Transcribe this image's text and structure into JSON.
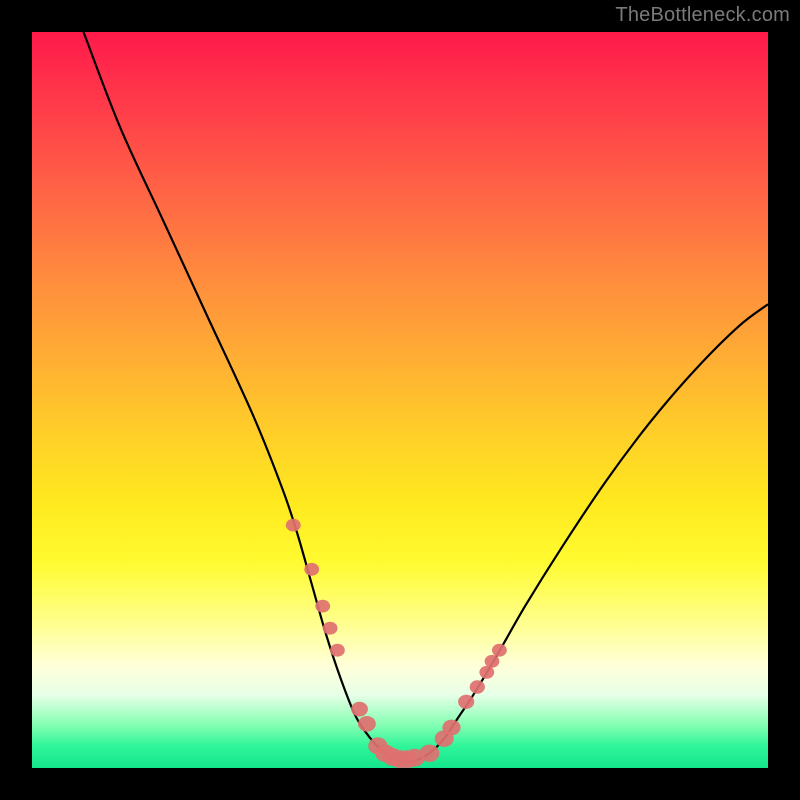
{
  "watermark": "TheBottleneck.com",
  "chart_data": {
    "type": "line",
    "title": "",
    "xlabel": "",
    "ylabel": "",
    "xlim": [
      0,
      100
    ],
    "ylim": [
      0,
      100
    ],
    "grid": false,
    "series": [
      {
        "name": "curve",
        "x": [
          7,
          12,
          18,
          24,
          30,
          34,
          36,
          38,
          40,
          42,
          44,
          46,
          48,
          50,
          52,
          54,
          56,
          58,
          60,
          63,
          67,
          72,
          78,
          84,
          90,
          96,
          100
        ],
        "y": [
          100,
          87,
          74,
          61,
          48,
          38,
          32,
          25,
          18,
          12,
          7,
          4,
          2,
          1,
          1,
          2,
          4,
          7,
          10,
          15,
          22,
          30,
          39,
          47,
          54,
          60,
          63
        ],
        "color": "#000000"
      },
      {
        "name": "marker-dots",
        "x": [
          35.5,
          38,
          39.5,
          40.5,
          41.5,
          44.5,
          45.5,
          47,
          48,
          49,
          50,
          51,
          52,
          54,
          56,
          57,
          59,
          60.5,
          61.8,
          62.5,
          63.5
        ],
        "y": [
          33,
          27,
          22,
          19,
          16,
          8,
          6,
          3,
          2,
          1.5,
          1.2,
          1.2,
          1.4,
          2,
          4,
          5.5,
          9,
          11,
          13,
          14.5,
          16
        ],
        "color": "#e07070"
      }
    ],
    "annotations": []
  }
}
